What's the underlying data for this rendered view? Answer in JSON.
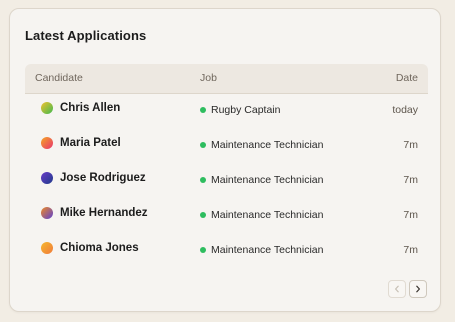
{
  "card": {
    "title": "Latest Applications"
  },
  "table": {
    "headers": {
      "candidate": "Candidate",
      "job": "Job",
      "date": "Date"
    },
    "rows": [
      {
        "name": "Chris Allen",
        "job": "Rugby Captain",
        "date": "today",
        "avatar_colors": [
          "#f2c12e",
          "#3fb94f"
        ],
        "status_color": "#2ebd5f"
      },
      {
        "name": "Maria Patel",
        "job": "Maintenance Technician",
        "date": "7m",
        "avatar_colors": [
          "#f5a623",
          "#e8336f"
        ],
        "status_color": "#2ebd5f"
      },
      {
        "name": "Jose Rodriguez",
        "job": "Maintenance Technician",
        "date": "7m",
        "avatar_colors": [
          "#6a3cc9",
          "#1f3a8a"
        ],
        "status_color": "#2ebd5f"
      },
      {
        "name": "Mike Hernandez",
        "job": "Maintenance Technician",
        "date": "7m",
        "avatar_colors": [
          "#f08a24",
          "#5b3fd1"
        ],
        "status_color": "#2ebd5f"
      },
      {
        "name": "Chioma Jones",
        "job": "Maintenance Technician",
        "date": "7m",
        "avatar_colors": [
          "#f5b82e",
          "#f07a3a"
        ],
        "status_color": "#2ebd5f"
      }
    ]
  },
  "pagination": {
    "prev_icon": "chevron-left-icon",
    "next_icon": "chevron-right-icon",
    "prev_disabled": true
  }
}
